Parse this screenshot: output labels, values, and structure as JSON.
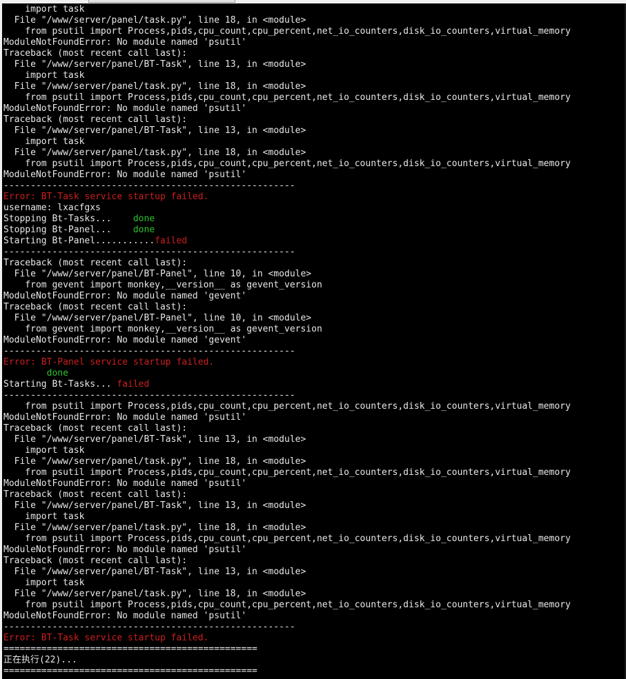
{
  "terminal": {
    "lines": [
      [
        {
          "t": "    import task",
          "c": "white"
        }
      ],
      [
        {
          "t": "  File \"/www/server/panel/task.py\", line 18, in <module>",
          "c": "white"
        }
      ],
      [
        {
          "t": "    from psutil import Process,pids,cpu_count,cpu_percent,net_io_counters,disk_io_counters,virtual_memory",
          "c": "white"
        }
      ],
      [
        {
          "t": "ModuleNotFoundError: No module named 'psutil'",
          "c": "white"
        }
      ],
      [
        {
          "t": "Traceback (most recent call last):",
          "c": "white"
        }
      ],
      [
        {
          "t": "  File \"/www/server/panel/BT-Task\", line 13, in <module>",
          "c": "white"
        }
      ],
      [
        {
          "t": "    import task",
          "c": "white"
        }
      ],
      [
        {
          "t": "  File \"/www/server/panel/task.py\", line 18, in <module>",
          "c": "white"
        }
      ],
      [
        {
          "t": "    from psutil import Process,pids,cpu_count,cpu_percent,net_io_counters,disk_io_counters,virtual_memory",
          "c": "white"
        }
      ],
      [
        {
          "t": "ModuleNotFoundError: No module named 'psutil'",
          "c": "white"
        }
      ],
      [
        {
          "t": "Traceback (most recent call last):",
          "c": "white"
        }
      ],
      [
        {
          "t": "  File \"/www/server/panel/BT-Task\", line 13, in <module>",
          "c": "white"
        }
      ],
      [
        {
          "t": "    import task",
          "c": "white"
        }
      ],
      [
        {
          "t": "  File \"/www/server/panel/task.py\", line 18, in <module>",
          "c": "white"
        }
      ],
      [
        {
          "t": "    from psutil import Process,pids,cpu_count,cpu_percent,net_io_counters,disk_io_counters,virtual_memory",
          "c": "white"
        }
      ],
      [
        {
          "t": "ModuleNotFoundError: No module named 'psutil'",
          "c": "white"
        }
      ],
      [
        {
          "t": "------------------------------------------------------",
          "c": "white"
        }
      ],
      [
        {
          "t": "Error: BT-Task service startup failed.",
          "c": "red"
        }
      ],
      [
        {
          "t": "username: lxacfgxs",
          "c": "white"
        }
      ],
      [
        {
          "t": "Stopping Bt-Tasks...    ",
          "c": "white"
        },
        {
          "t": "done",
          "c": "green"
        }
      ],
      [
        {
          "t": "Stopping Bt-Panel...    ",
          "c": "white"
        },
        {
          "t": "done",
          "c": "green"
        }
      ],
      [
        {
          "t": "Starting Bt-Panel...........",
          "c": "white"
        },
        {
          "t": "failed",
          "c": "red"
        }
      ],
      [
        {
          "t": "------------------------------------------------------",
          "c": "white"
        }
      ],
      [
        {
          "t": "Traceback (most recent call last):",
          "c": "white"
        }
      ],
      [
        {
          "t": "  File \"/www/server/panel/BT-Panel\", line 10, in <module>",
          "c": "white"
        }
      ],
      [
        {
          "t": "    from gevent import monkey,__version__ as gevent_version",
          "c": "white"
        }
      ],
      [
        {
          "t": "ModuleNotFoundError: No module named 'gevent'",
          "c": "white"
        }
      ],
      [
        {
          "t": "Traceback (most recent call last):",
          "c": "white"
        }
      ],
      [
        {
          "t": "  File \"/www/server/panel/BT-Panel\", line 10, in <module>",
          "c": "white"
        }
      ],
      [
        {
          "t": "    from gevent import monkey,__version__ as gevent_version",
          "c": "white"
        }
      ],
      [
        {
          "t": "ModuleNotFoundError: No module named 'gevent'",
          "c": "white"
        }
      ],
      [
        {
          "t": "------------------------------------------------------",
          "c": "white"
        }
      ],
      [
        {
          "t": "Error: BT-Panel service startup failed.",
          "c": "red"
        }
      ],
      [
        {
          "t": "        ",
          "c": "white"
        },
        {
          "t": "done",
          "c": "green"
        }
      ],
      [
        {
          "t": "Starting Bt-Tasks... ",
          "c": "white"
        },
        {
          "t": "failed",
          "c": "red"
        }
      ],
      [
        {
          "t": "------------------------------------------------------",
          "c": "white"
        }
      ],
      [
        {
          "t": "    from psutil import Process,pids,cpu_count,cpu_percent,net_io_counters,disk_io_counters,virtual_memory",
          "c": "white"
        }
      ],
      [
        {
          "t": "ModuleNotFoundError: No module named 'psutil'",
          "c": "white"
        }
      ],
      [
        {
          "t": "Traceback (most recent call last):",
          "c": "white"
        }
      ],
      [
        {
          "t": "  File \"/www/server/panel/BT-Task\", line 13, in <module>",
          "c": "white"
        }
      ],
      [
        {
          "t": "    import task",
          "c": "white"
        }
      ],
      [
        {
          "t": "  File \"/www/server/panel/task.py\", line 18, in <module>",
          "c": "white"
        }
      ],
      [
        {
          "t": "    from psutil import Process,pids,cpu_count,cpu_percent,net_io_counters,disk_io_counters,virtual_memory",
          "c": "white"
        }
      ],
      [
        {
          "t": "ModuleNotFoundError: No module named 'psutil'",
          "c": "white"
        }
      ],
      [
        {
          "t": "Traceback (most recent call last):",
          "c": "white"
        }
      ],
      [
        {
          "t": "  File \"/www/server/panel/BT-Task\", line 13, in <module>",
          "c": "white"
        }
      ],
      [
        {
          "t": "    import task",
          "c": "white"
        }
      ],
      [
        {
          "t": "  File \"/www/server/panel/task.py\", line 18, in <module>",
          "c": "white"
        }
      ],
      [
        {
          "t": "    from psutil import Process,pids,cpu_count,cpu_percent,net_io_counters,disk_io_counters,virtual_memory",
          "c": "white"
        }
      ],
      [
        {
          "t": "ModuleNotFoundError: No module named 'psutil'",
          "c": "white"
        }
      ],
      [
        {
          "t": "Traceback (most recent call last):",
          "c": "white"
        }
      ],
      [
        {
          "t": "  File \"/www/server/panel/BT-Task\", line 13, in <module>",
          "c": "white"
        }
      ],
      [
        {
          "t": "    import task",
          "c": "white"
        }
      ],
      [
        {
          "t": "  File \"/www/server/panel/task.py\", line 18, in <module>",
          "c": "white"
        }
      ],
      [
        {
          "t": "    from psutil import Process,pids,cpu_count,cpu_percent,net_io_counters,disk_io_counters,virtual_memory",
          "c": "white"
        }
      ],
      [
        {
          "t": "ModuleNotFoundError: No module named 'psutil'",
          "c": "white"
        }
      ],
      [
        {
          "t": "------------------------------------------------------",
          "c": "white"
        }
      ],
      [
        {
          "t": "Error: BT-Task service startup failed.",
          "c": "red"
        }
      ],
      [
        {
          "t": "===============================================",
          "c": "white"
        }
      ],
      [
        {
          "t": "正在执行(22)...",
          "c": "white"
        }
      ],
      [
        {
          "t": "===============================================",
          "c": "white"
        }
      ]
    ]
  },
  "colors": {
    "background": "#000000",
    "text": "#e8e8e8",
    "error_red": "#cc1f1f",
    "success_green": "#2ec22e"
  }
}
